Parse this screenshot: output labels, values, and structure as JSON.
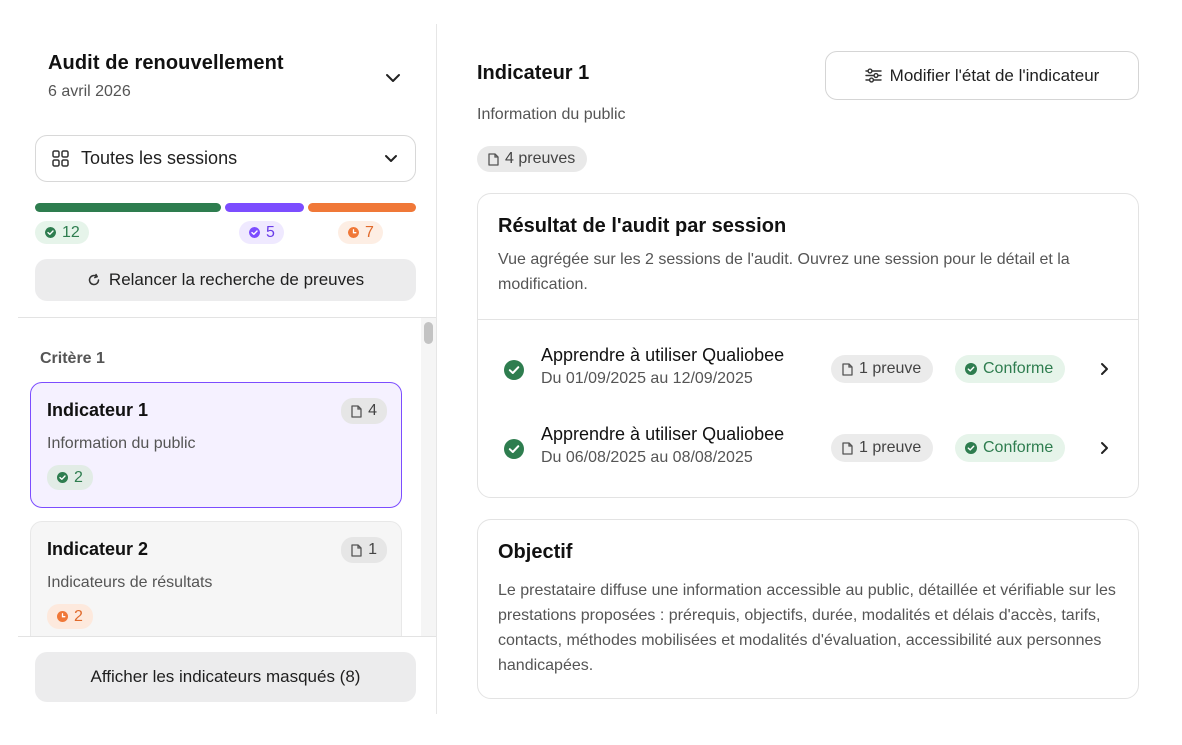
{
  "sidebar": {
    "audit": {
      "title": "Audit de renouvellement",
      "date": "6 avril 2026"
    },
    "session_select": {
      "label": "Toutes les sessions"
    },
    "progress": {
      "conforme": {
        "count": "12",
        "color": "#2e7d4f"
      },
      "en_cours": {
        "count": "5",
        "color": "#7c4dff"
      },
      "a_traiter": {
        "count": "7",
        "color": "#f07838"
      }
    },
    "relaunch_label": "Relancer la recherche de preuves",
    "criterion_label": "Critère 1",
    "indicators": [
      {
        "name": "Indicateur 1",
        "description": "Information du public",
        "docs": "4",
        "status_count": "2",
        "status": "conforme"
      },
      {
        "name": "Indicateur 2",
        "description": "Indicateurs de résultats",
        "docs": "1",
        "status_count": "2",
        "status": "a_traiter"
      }
    ],
    "hidden_button_label": "Afficher les indicateurs masqués (8)"
  },
  "main": {
    "title": "Indicateur 1",
    "subtitle": "Information du public",
    "proofs": "4 preuves",
    "modify_label": "Modifier l'état de l'indicateur",
    "result_card": {
      "title": "Résultat de l'audit par session",
      "lead": "Vue agrégée sur les 2 sessions de l'audit. Ouvrez une session pour le détail et la modification.",
      "sessions": [
        {
          "name": "Apprendre à utiliser Qualiobee",
          "dates": "Du 01/09/2025 au 12/09/2025",
          "proofs": "1 preuve",
          "status": "Conforme"
        },
        {
          "name": "Apprendre à utiliser Qualiobee",
          "dates": "Du 06/08/2025 au 08/08/2025",
          "proofs": "1 preuve",
          "status": "Conforme"
        }
      ]
    },
    "objective_card": {
      "title": "Objectif",
      "body": "Le prestataire diffuse une information accessible au public, détaillée et vérifiable sur les prestations proposées : prérequis, objectifs, durée, modalités et délais d'accès, tarifs, contacts, méthodes mobilisées et modalités d'évaluation, accessibilité aux personnes handicapées."
    }
  },
  "colors": {
    "accent": "#7c4dff",
    "success": "#2e7d4f",
    "warning": "#f07838"
  }
}
